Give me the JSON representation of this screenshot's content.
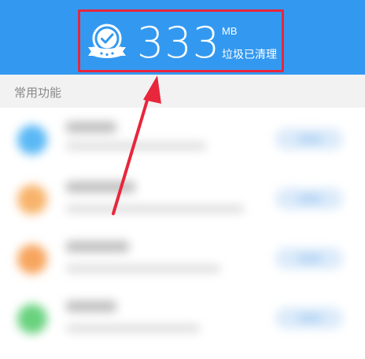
{
  "header": {
    "cleaned_amount": "333",
    "unit": "MB",
    "cleaned_label": "垃圾已清理",
    "accent_color": "#3399f0",
    "highlight_color": "#e8263c",
    "icon": "verified-badge-icon"
  },
  "section": {
    "title": "常用功能"
  },
  "list": {
    "items": [
      {
        "icon_color": "#5ab8f5"
      },
      {
        "icon_color": "#f8b36b"
      },
      {
        "icon_color": "#f7a55e"
      },
      {
        "icon_color": "#69d27e"
      }
    ]
  },
  "annotation": {
    "arrow": "red-arrow-icon"
  }
}
